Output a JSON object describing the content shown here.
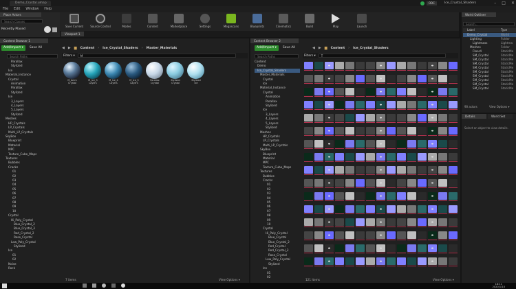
{
  "window": {
    "title": "Demo_Crystal.umap",
    "project": "Ice_Crystal_Shaders",
    "badge": "ODC"
  },
  "menu": [
    "File",
    "Edit",
    "Window",
    "Help"
  ],
  "place": {
    "title": "Place Actors",
    "search_placeholder": "Search Classes",
    "recent": "Recently Placed"
  },
  "toolbar": [
    "Save Current",
    "Source Control",
    "Modes",
    "Content",
    "Marketplace",
    "Settings",
    "Megascans",
    "Blueprints",
    "Cinematics",
    "Build",
    "Play",
    "Launch"
  ],
  "viewport_tab": "Viewport 1",
  "cb1": {
    "tab": "Content Browser 1",
    "add": "Add/Import ▾",
    "save": "Save All",
    "crumb": [
      "Content",
      "Ice_Crystal_Shaders",
      "Master_Materials"
    ],
    "search_paths": "Search Paths",
    "filters": "Filters ▾",
    "search_value": "M",
    "status": "7 items",
    "view": "View Options ▾",
    "tree": [
      "Parallax",
      "Stylized",
      "Ice",
      "Material_Instance",
      "Crystal",
      "Animation",
      "Parallax",
      "Stylized",
      "Ice",
      "3_Layers",
      "4_Layers",
      "5_Layers",
      "Stylized",
      "Meshes",
      "HP_Crystals",
      "LP_Crystals",
      "Multi_LP_Crystals",
      "SkyBox",
      "Blueprint",
      "Material",
      "MPC",
      "Texture_Cube_Maps",
      "Textures",
      "Bubbles",
      "Cracks",
      "01",
      "02",
      "03",
      "04",
      "05",
      "06",
      "07",
      "08",
      "09",
      "10",
      "Crystal",
      "Hi_Poly_Crystal",
      "Blue_Crystal_2",
      "Blue_Crystal_3",
      "Red_Crystal_2",
      "Rose_Crystal",
      "Low_Poly_Crystal",
      "Stylized",
      "Ice",
      "01",
      "02",
      "Noise",
      "Rock"
    ],
    "assets": [
      {
        "line1": "M_Anim",
        "line2": "Crystal"
      },
      {
        "line1": "M_Ice_3",
        "line2": "Layers"
      },
      {
        "line1": "M_Ice_4",
        "line2": "Layers"
      },
      {
        "line1": "M_Ice_5",
        "line2": "Layers"
      },
      {
        "line1": "Parallax",
        "line2": "Crystal"
      },
      {
        "line1": "Stylized",
        "line2": "Crystal"
      },
      {
        "line1": "Stylized",
        "line2": "Ice"
      }
    ]
  },
  "cb2": {
    "tab": "Content Browser 2",
    "add": "Add/Import ▾",
    "save": "Save All",
    "crumb": [
      "Content",
      "Ice_Crystal_Shaders"
    ],
    "search_paths": "Search Paths",
    "filters": "Filters ▾",
    "search_value": "T",
    "status": "121 items",
    "view": "View Options ▾",
    "tree": [
      "Content",
      "Demo",
      "Ice_Crystal_Shaders",
      "Master_Materials",
      "Crystal",
      "Ice",
      "Material_Instance",
      "Crystal",
      "Animation",
      "Parallax",
      "Stylized",
      "Ice",
      "3_Layers",
      "4_Layers",
      "5_Layers",
      "Stylized",
      "Meshes",
      "HP_Crystals",
      "LP_Crystals",
      "Multi_LP_Crystals",
      "SkyBox",
      "Blueprint",
      "Material",
      "MPC",
      "Texture_Cube_Maps",
      "Textures",
      "Bubbles",
      "Cracks",
      "01",
      "02",
      "03",
      "04",
      "05",
      "06",
      "07",
      "08",
      "09",
      "10",
      "Crystal",
      "Hi_Poly_Crystal",
      "Blue_Crystal",
      "Blue_Crystal_2",
      "Red_Crystal",
      "Red_Crystal_2",
      "Rose_Crystal",
      "Low_Poly_Crystal",
      "Stylized",
      "Ice",
      "01",
      "02"
    ]
  },
  "outliner": {
    "tab": "World Outliner",
    "search_placeholder": "Search...",
    "col_label": "Label",
    "col_type": "Type",
    "rows": [
      {
        "name": "Demo_Crystal",
        "type": "World"
      },
      {
        "name": "Lighting",
        "type": "Folder"
      },
      {
        "name": "Lightmass",
        "type": "Lightma"
      },
      {
        "name": "Meshes",
        "type": "Folder"
      },
      {
        "name": "Floor4",
        "type": "StaticMe"
      },
      {
        "name": "SM_Crystal",
        "type": "StaticMe"
      },
      {
        "name": "SM_Crystal",
        "type": "StaticMe"
      },
      {
        "name": "SM_Crystal",
        "type": "StaticMe"
      },
      {
        "name": "SM_Crystal",
        "type": "StaticMe"
      },
      {
        "name": "SM_Crystal",
        "type": "StaticMe"
      },
      {
        "name": "SM_Crystal",
        "type": "StaticMe"
      },
      {
        "name": "SM_Crystal",
        "type": "StaticMe"
      },
      {
        "name": "SM_Crystal",
        "type": "StaticMe"
      },
      {
        "name": "SM_Crystal",
        "type": "StaticMe"
      }
    ],
    "count": "90 actors",
    "view": "View Options ▾"
  },
  "details": {
    "tab": "Details",
    "tab2": "World Set",
    "hint": "Select an object to view details."
  },
  "taskbar": {
    "time": "18:11",
    "date": "2020/1/10"
  }
}
